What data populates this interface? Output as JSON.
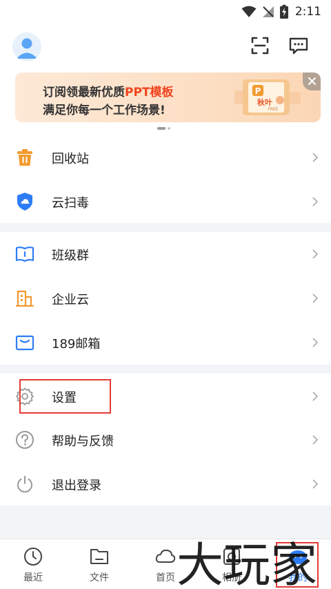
{
  "status": {
    "time": "2:11"
  },
  "banner": {
    "line1_prefix": "订阅领最新优质",
    "line1_highlight": "PPT模板",
    "line2": "满足你每一个工作场景!",
    "badge_letter": "P",
    "badge_text": "秋叶",
    "badge_sub": "FREE"
  },
  "menu": {
    "recycle": "回收站",
    "scan": "云扫毒",
    "class_group": "班级群",
    "enterprise": "企业云",
    "mailbox": "189邮箱",
    "settings": "设置",
    "help": "帮助与反馈",
    "logout": "退出登录"
  },
  "tabs": [
    {
      "label": "最近"
    },
    {
      "label": "文件"
    },
    {
      "label": "首页"
    },
    {
      "label": "相册"
    },
    {
      "label": "我的"
    }
  ],
  "watermark": "大玩家",
  "colors": {
    "accent": "#2d7cf6",
    "recycle": "#f29a2e",
    "scan": "#2d7cf6",
    "enterprise": "#f29a2e",
    "highlight_red": "#e53935",
    "banner_highlight": "#f0451f"
  }
}
